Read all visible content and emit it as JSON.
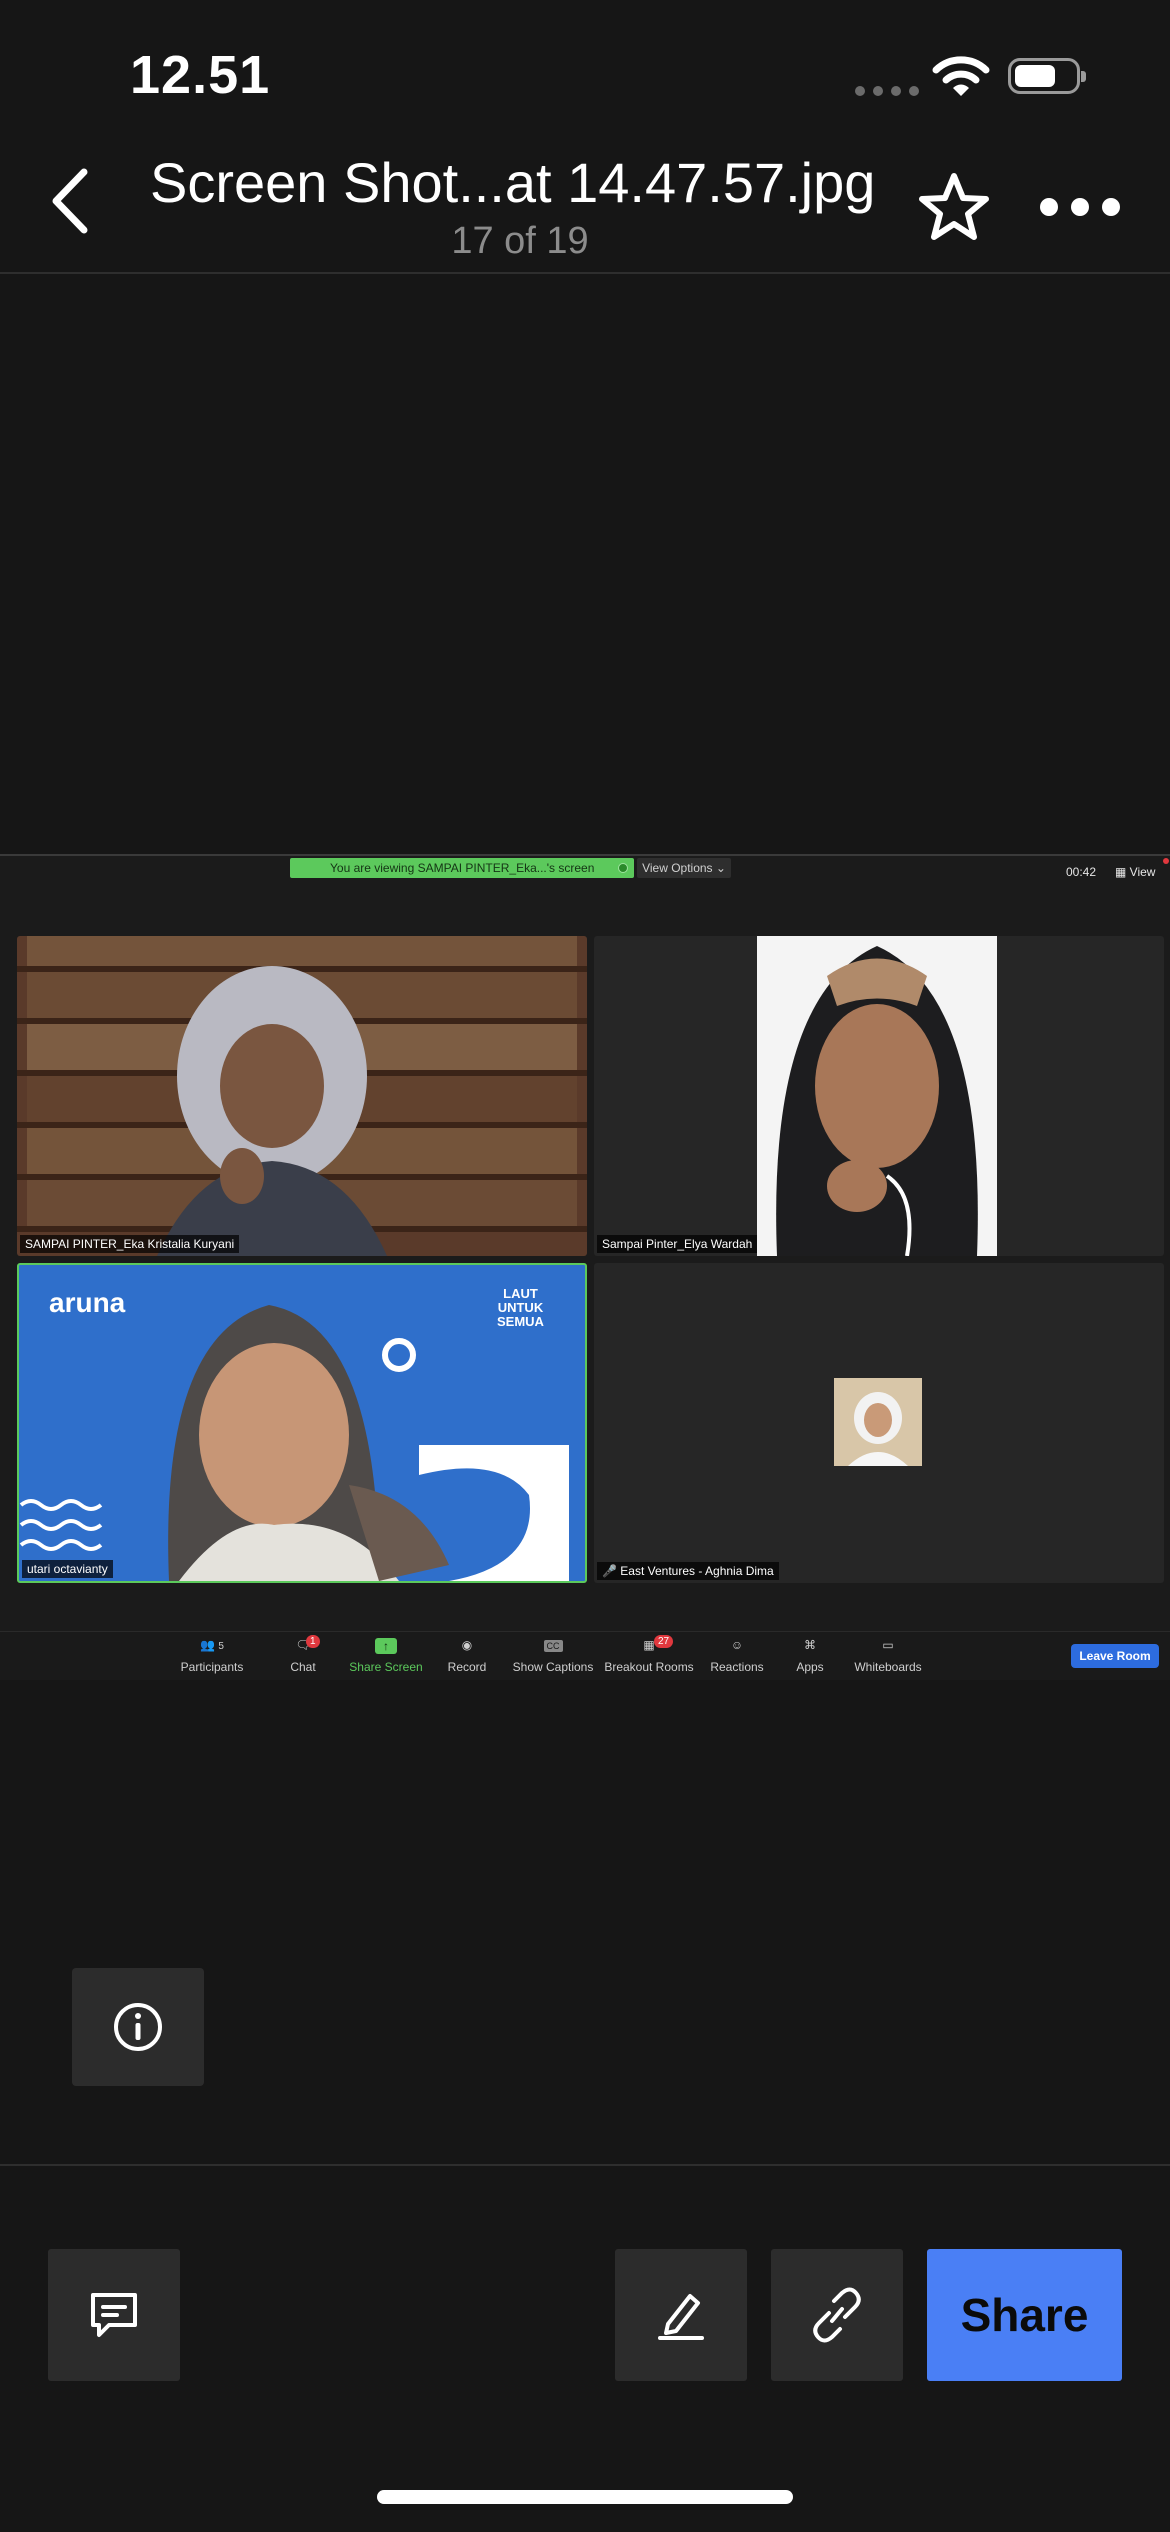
{
  "status_bar": {
    "time": "12.51"
  },
  "header": {
    "title": "Screen Shot...at 14.47.57.jpg",
    "counter": "17 of 19"
  },
  "zoom": {
    "banner": "You are viewing SAMPAI PINTER_Eka...'s screen",
    "view_options": "View Options",
    "timer": "00:42",
    "view_label": "View",
    "participants": [
      {
        "name": "SAMPAI PINTER_Eka Kristalia Kuryani"
      },
      {
        "name": "Sampai Pinter_Elya Wardah"
      },
      {
        "name": "utari octavianty",
        "background_brand": "aruna",
        "background_slogan": [
          "LAUT",
          "UNTUK",
          "SEMUA"
        ]
      },
      {
        "name": "East Ventures - Aghnia Dima"
      }
    ],
    "toolbar": [
      {
        "label": "Participants",
        "count": "5",
        "icon": "participants-icon"
      },
      {
        "label": "Chat",
        "badge": "1",
        "icon": "chat-icon"
      },
      {
        "label": "Share Screen",
        "icon": "share-screen-icon"
      },
      {
        "label": "Record",
        "icon": "record-icon"
      },
      {
        "label": "Show Captions",
        "icon": "captions-icon",
        "icon_text": "CC"
      },
      {
        "label": "Breakout Rooms",
        "badge": "27",
        "icon": "breakout-rooms-icon"
      },
      {
        "label": "Reactions",
        "icon": "reactions-icon"
      },
      {
        "label": "Apps",
        "icon": "apps-icon"
      },
      {
        "label": "Whiteboards",
        "icon": "whiteboards-icon"
      }
    ],
    "leave_button": "Leave Room"
  },
  "bottom": {
    "share_label": "Share"
  },
  "colors": {
    "accent": "#4a7ff5",
    "zoom_green": "#5cc95c",
    "leave_blue": "#2d6cdf"
  }
}
